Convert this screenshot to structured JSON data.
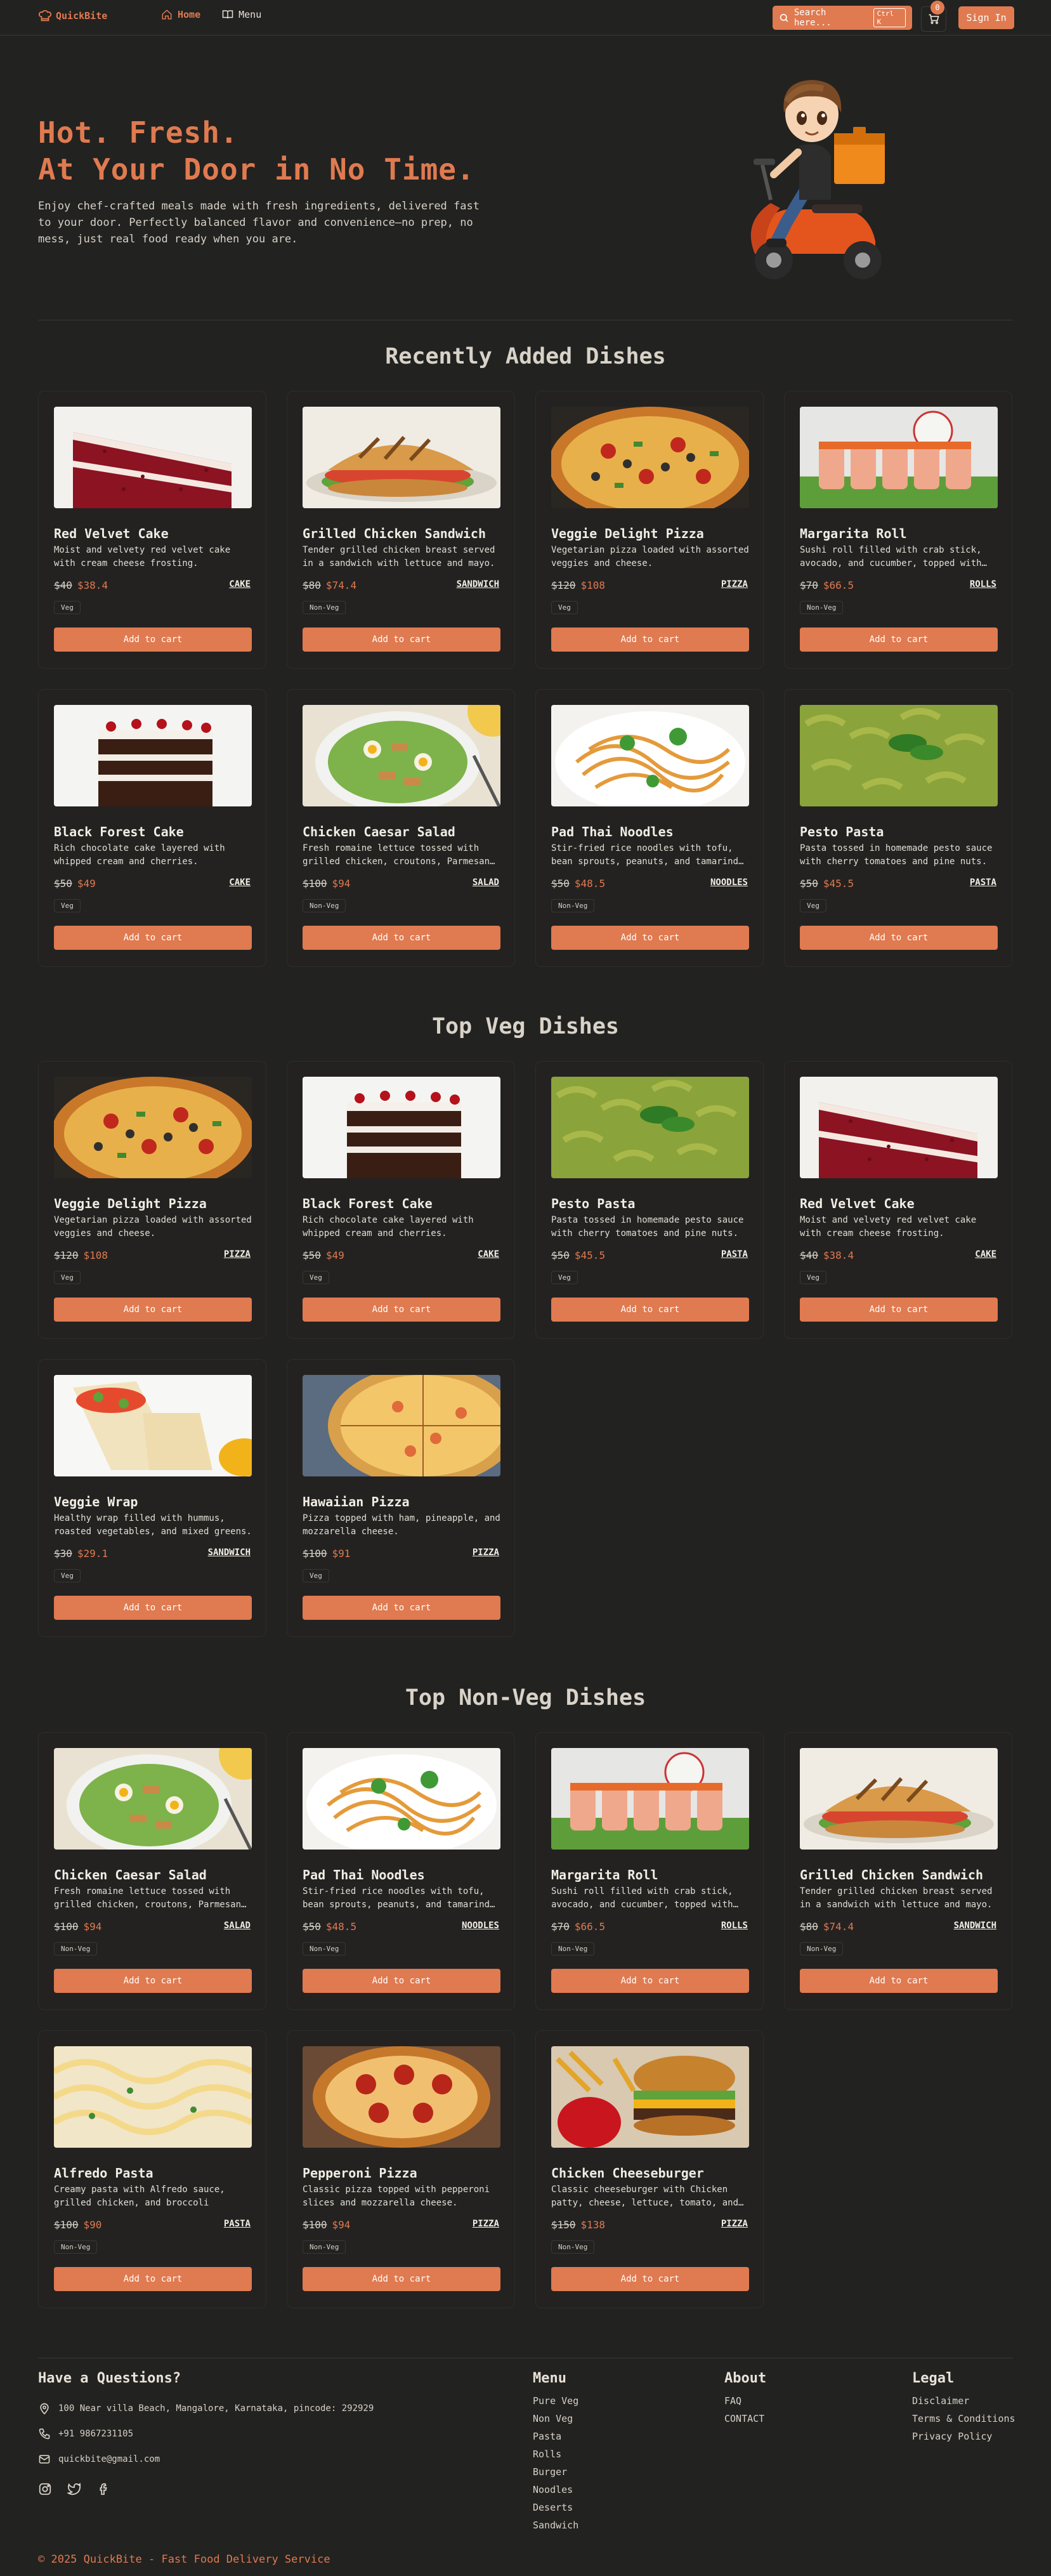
{
  "nav": {
    "brand": "QuickBite",
    "links": [
      {
        "label": "Home"
      },
      {
        "label": "Menu"
      }
    ],
    "search_placeholder": "Search here...",
    "search_shortcut": "Ctrl K",
    "cart_count": "0",
    "signin_label": "Sign In"
  },
  "hero": {
    "title_line1": "Hot. Fresh.",
    "title_line2": "At Your Door in No Time.",
    "description": "Enjoy chef-crafted meals made with fresh ingredients, delivered fast to your door. Perfectly balanced flavor and convenience—no prep, no mess, just real food ready when you are."
  },
  "colors": {
    "accent": "#e07a50",
    "background": "#222220"
  },
  "sections": [
    {
      "title": "Recently Added Dishes",
      "dishes": [
        {
          "name": "Red Velvet Cake",
          "desc": "Moist and velvety red velvet cake with cream cheese frosting.",
          "old_price": "$40",
          "price": "$38.4",
          "category": "CAKE",
          "type": "Veg",
          "art": "redvelvet"
        },
        {
          "name": "Grilled Chicken Sandwich",
          "desc": "Tender grilled chicken breast served in a sandwich with lettuce and mayo.",
          "old_price": "$80",
          "price": "$74.4",
          "category": "SANDWICH",
          "type": "Non-Veg",
          "art": "sandwich"
        },
        {
          "name": "Veggie Delight Pizza",
          "desc": "Vegetarian pizza loaded with assorted veggies and cheese.",
          "old_price": "$120",
          "price": "$108",
          "category": "PIZZA",
          "type": "Veg",
          "art": "veggiepizza"
        },
        {
          "name": "Margarita Roll",
          "desc": "Sushi roll filled with crab stick, avocado, and cucumber, topped with…",
          "old_price": "$70",
          "price": "$66.5",
          "category": "ROLLS",
          "type": "Non-Veg",
          "art": "roll"
        },
        {
          "name": "Black Forest Cake",
          "desc": "Rich chocolate cake layered with whipped cream and cherries.",
          "old_price": "$50",
          "price": "$49",
          "category": "CAKE",
          "type": "Veg",
          "art": "blackforest"
        },
        {
          "name": "Chicken Caesar Salad",
          "desc": "Fresh romaine lettuce tossed with grilled chicken, croutons, Parmesan…",
          "old_price": "$100",
          "price": "$94",
          "category": "SALAD",
          "type": "Non-Veg",
          "art": "salad"
        },
        {
          "name": "Pad Thai Noodles",
          "desc": "Stir-fried rice noodles with tofu, bean sprouts, peanuts, and tamarind…",
          "old_price": "$50",
          "price": "$48.5",
          "category": "NOODLES",
          "type": "Non-Veg",
          "art": "noodles"
        },
        {
          "name": "Pesto Pasta",
          "desc": "Pasta tossed in homemade pesto sauce with cherry tomatoes and pine nuts.",
          "old_price": "$50",
          "price": "$45.5",
          "category": "PASTA",
          "type": "Veg",
          "art": "pesto"
        }
      ]
    },
    {
      "title": "Top Veg Dishes",
      "dishes": [
        {
          "name": "Veggie Delight Pizza",
          "desc": "Vegetarian pizza loaded with assorted veggies and cheese.",
          "old_price": "$120",
          "price": "$108",
          "category": "PIZZA",
          "type": "Veg",
          "art": "veggiepizza"
        },
        {
          "name": "Black Forest Cake",
          "desc": "Rich chocolate cake layered with whipped cream and cherries.",
          "old_price": "$50",
          "price": "$49",
          "category": "CAKE",
          "type": "Veg",
          "art": "blackforest"
        },
        {
          "name": "Pesto Pasta",
          "desc": "Pasta tossed in homemade pesto sauce with cherry tomatoes and pine nuts.",
          "old_price": "$50",
          "price": "$45.5",
          "category": "PASTA",
          "type": "Veg",
          "art": "pesto"
        },
        {
          "name": "Red Velvet Cake",
          "desc": "Moist and velvety red velvet cake with cream cheese frosting.",
          "old_price": "$40",
          "price": "$38.4",
          "category": "CAKE",
          "type": "Veg",
          "art": "redvelvet"
        },
        {
          "name": "Veggie Wrap",
          "desc": "Healthy wrap filled with hummus, roasted vegetables, and mixed greens.",
          "old_price": "$30",
          "price": "$29.1",
          "category": "SANDWICH",
          "type": "Veg",
          "art": "wrap"
        },
        {
          "name": "Hawaiian Pizza",
          "desc": "Pizza topped with ham, pineapple, and mozzarella cheese.",
          "old_price": "$100",
          "price": "$91",
          "category": "PIZZA",
          "type": "Veg",
          "art": "hawaiian"
        }
      ]
    },
    {
      "title": "Top Non-Veg Dishes",
      "dishes": [
        {
          "name": "Chicken Caesar Salad",
          "desc": "Fresh romaine lettuce tossed with grilled chicken, croutons, Parmesan…",
          "old_price": "$100",
          "price": "$94",
          "category": "SALAD",
          "type": "Non-Veg",
          "art": "salad"
        },
        {
          "name": "Pad Thai Noodles",
          "desc": "Stir-fried rice noodles with tofu, bean sprouts, peanuts, and tamarind…",
          "old_price": "$50",
          "price": "$48.5",
          "category": "NOODLES",
          "type": "Non-Veg",
          "art": "noodles"
        },
        {
          "name": "Margarita Roll",
          "desc": "Sushi roll filled with crab stick, avocado, and cucumber, topped with…",
          "old_price": "$70",
          "price": "$66.5",
          "category": "ROLLS",
          "type": "Non-Veg",
          "art": "roll"
        },
        {
          "name": "Grilled Chicken Sandwich",
          "desc": "Tender grilled chicken breast served in a sandwich with lettuce and mayo.",
          "old_price": "$80",
          "price": "$74.4",
          "category": "SANDWICH",
          "type": "Non-Veg",
          "art": "sandwich"
        },
        {
          "name": "Alfredo Pasta",
          "desc": "Creamy pasta with Alfredo sauce, grilled chicken, and broccoli florets.",
          "old_price": "$100",
          "price": "$90",
          "category": "PASTA",
          "type": "Non-Veg",
          "art": "alfredo"
        },
        {
          "name": "Pepperoni Pizza",
          "desc": "Classic pizza topped with pepperoni slices and mozzarella cheese.",
          "old_price": "$100",
          "price": "$94",
          "category": "PIZZA",
          "type": "Non-Veg",
          "art": "pepperoni"
        },
        {
          "name": "Chicken Cheeseburger",
          "desc": "Classic cheeseburger with Chicken patty, cheese, lettuce, tomato, and…",
          "old_price": "$150",
          "price": "$138",
          "category": "PIZZA",
          "type": "Non-Veg",
          "art": "burger"
        }
      ]
    }
  ],
  "add_to_cart_label": "Add to cart",
  "footer": {
    "question_title": "Have a Questions?",
    "address": "100 Near villa Beach, Mangalore, Karnataka, pincode: 292929",
    "phone": "+91 9867231105",
    "email": "quickbite@gmail.com",
    "menu_title": "Menu",
    "menu_links": [
      "Pure Veg",
      "Non Veg",
      "Pasta",
      "Rolls",
      "Burger",
      "Noodles",
      "Deserts",
      "Sandwich"
    ],
    "about_title": "About",
    "about_links": [
      "FAQ",
      "CONTACT"
    ],
    "legal_title": "Legal",
    "legal_links": [
      "Disclaimer",
      "Terms & Conditions",
      "Privacy Policy"
    ],
    "copyright": "© 2025 QuickBite - Fast Food Delivery Service"
  }
}
